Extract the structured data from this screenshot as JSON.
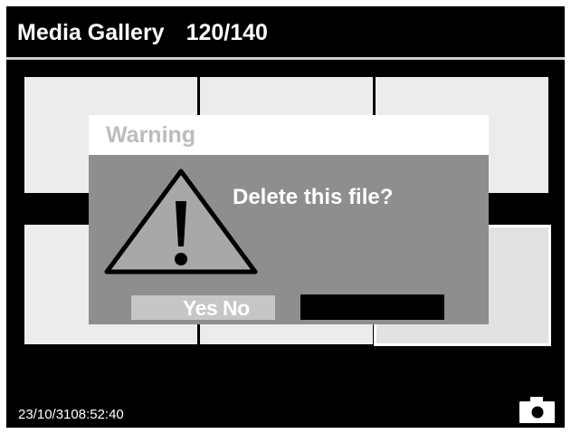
{
  "header": {
    "title": "Media Gallery",
    "counter": "120/140"
  },
  "gallery": {
    "selected_index": 5
  },
  "dialog": {
    "title": "Warning",
    "message": "Delete this file?",
    "icon": "warning-triangle-icon",
    "yes_no_label": "Yes No"
  },
  "footer": {
    "timestamp": "23/10/3108:52:40",
    "camera_icon": "camera-icon"
  },
  "colors": {
    "background": "#000000",
    "dialog": "#8e8e8e",
    "thumbnail": "#ececec"
  }
}
